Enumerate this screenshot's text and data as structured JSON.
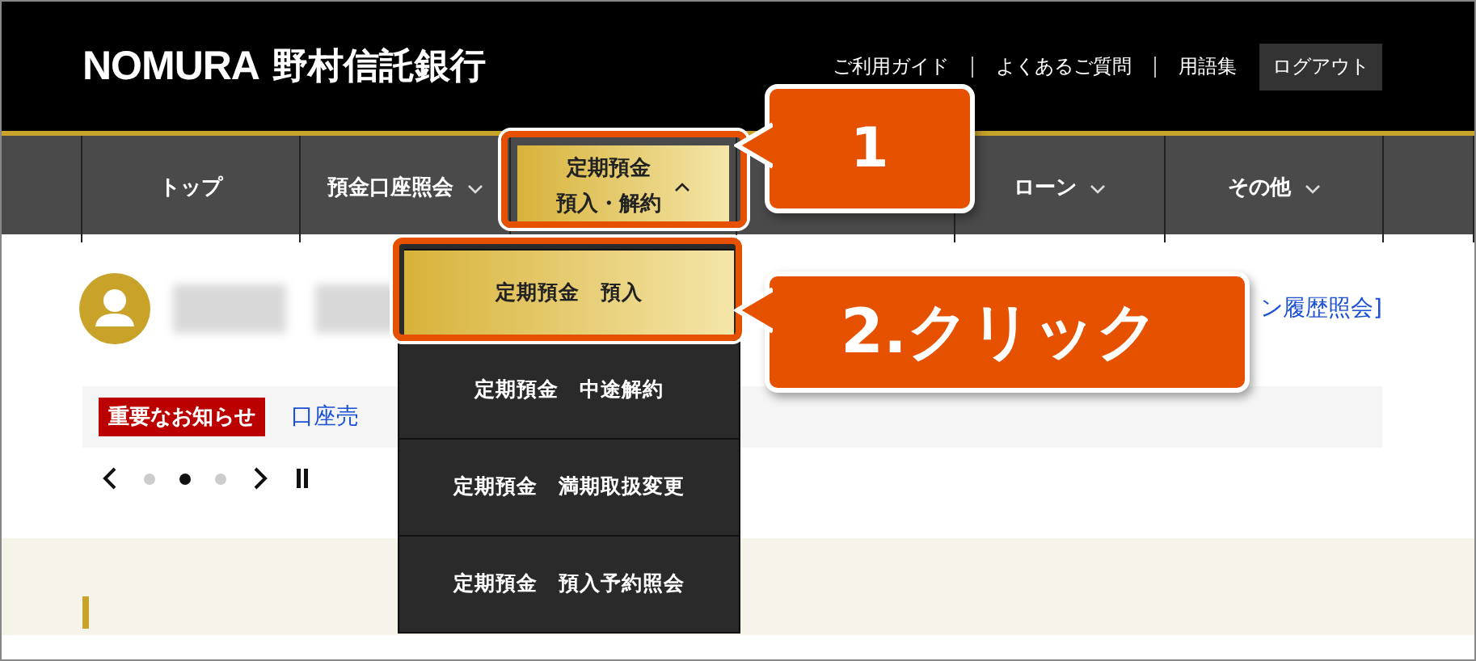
{
  "header": {
    "logo": "NOMURA",
    "bank_name": "野村信託銀行",
    "links": [
      "ご利用ガイド",
      "よくあるご質問",
      "用語集"
    ],
    "logout": "ログアウト"
  },
  "nav": [
    {
      "kind": "spacer"
    },
    {
      "kind": "item",
      "lines": [
        "トップ"
      ],
      "dropdown": false,
      "selected": false
    },
    {
      "kind": "item",
      "lines": [
        "預金口座照会"
      ],
      "dropdown": true,
      "expanded": false,
      "selected": false
    },
    {
      "kind": "item",
      "lines": [
        "定期預金",
        "預入・解約"
      ],
      "dropdown": true,
      "expanded": true,
      "selected": true
    },
    {
      "kind": "spacer"
    },
    {
      "kind": "item",
      "lines": [
        "ローン"
      ],
      "dropdown": true,
      "expanded": false,
      "selected": false
    },
    {
      "kind": "item",
      "lines": [
        "その他"
      ],
      "dropdown": true,
      "expanded": false,
      "selected": false
    },
    {
      "kind": "spacer"
    }
  ],
  "dropdown": [
    {
      "label": "定期預金　預入",
      "selected": true
    },
    {
      "label": "定期預金　中途解約",
      "selected": false
    },
    {
      "label": "定期預金　満期取扱変更",
      "selected": false
    },
    {
      "label": "定期預金　預入予約照会",
      "selected": false
    }
  ],
  "callouts": [
    "1",
    "2.クリック"
  ],
  "user": {
    "history_link": "ン履歴照会]"
  },
  "notice": {
    "badge": "重要なお知らせ",
    "link": "口座売"
  },
  "carousel": {
    "dots": [
      {
        "selected": false
      },
      {
        "selected": true
      },
      {
        "selected": false
      }
    ],
    "paused": false
  }
}
